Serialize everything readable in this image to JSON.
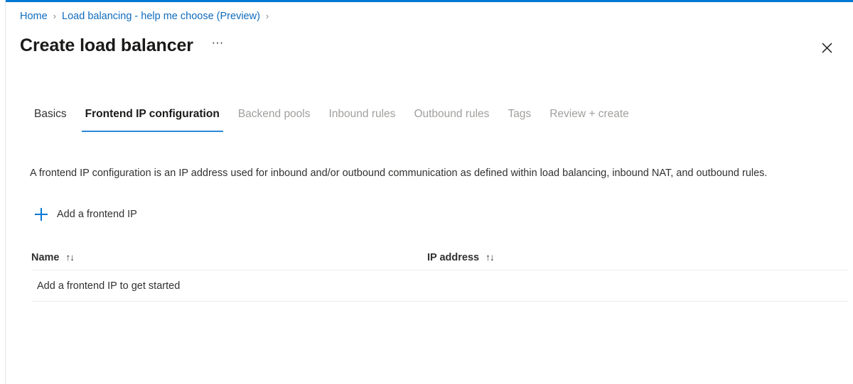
{
  "theme": {
    "accent": "#0078d4",
    "link": "#0f6cbd",
    "tab_underline": "#2b88d8",
    "text": "#323130",
    "text_disabled": "#a19f9d",
    "divider": "#edebe9"
  },
  "breadcrumb": {
    "separator": "›",
    "items": [
      {
        "label": "Home"
      },
      {
        "label": "Load balancing - help me choose (Preview)"
      }
    ],
    "trailing_separator": "›"
  },
  "header": {
    "title": "Create load balancer",
    "more_label": "···",
    "more_icon": "ellipsis-icon",
    "close_icon": "close-icon"
  },
  "tabs": [
    {
      "label": "Basics",
      "state": "enabled"
    },
    {
      "label": "Frontend IP configuration",
      "state": "active"
    },
    {
      "label": "Backend pools",
      "state": "disabled"
    },
    {
      "label": "Inbound rules",
      "state": "disabled"
    },
    {
      "label": "Outbound rules",
      "state": "disabled"
    },
    {
      "label": "Tags",
      "state": "disabled"
    },
    {
      "label": "Review + create",
      "state": "disabled"
    }
  ],
  "main": {
    "description": "A frontend IP configuration is an IP address used for inbound and/or outbound communication as defined within load balancing, inbound NAT, and outbound rules.",
    "add_command": {
      "label": "Add a frontend IP",
      "icon": "plus-icon"
    },
    "table": {
      "columns": [
        {
          "label": "Name",
          "sort_glyph": "↑↓"
        },
        {
          "label": "IP address",
          "sort_glyph": "↑↓"
        }
      ],
      "empty_message": "Add a frontend IP to get started"
    }
  }
}
